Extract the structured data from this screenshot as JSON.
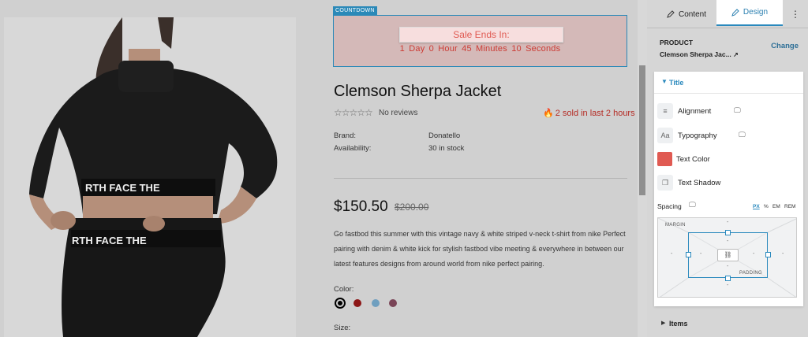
{
  "countdown": {
    "tag": "COUNTDOWN",
    "heading": "Sale Ends In:",
    "timer": "1 Day  0 Hour  45 Minutes  10 Seconds"
  },
  "product": {
    "title": "Clemson Sherpa Jacket",
    "stars": "☆☆☆☆☆",
    "reviews": "No reviews",
    "sold": "2 sold in last 2 hours",
    "brand_label": "Brand:",
    "brand_value": "Donatello",
    "availability_label": "Availability:",
    "availability_value": "30 in stock",
    "price": "$150.50",
    "old_price": "$200.00",
    "description": "Go fastbod this summer with this vintage navy & white striped v-neck t-shirt from nike Perfect pairing with denim & white kick for stylish fastbod vibe meeting & everywhere in between our latest features designs from around world from nike perfect pairing.",
    "color_label": "Color:",
    "swatches": [
      "#000000",
      "#8c1616",
      "#6f9fbf",
      "#7a4557"
    ],
    "size_label": "Size:",
    "image_print_1": "RTH FACE  THE",
    "image_print_2": "RTH FACE  THE"
  },
  "panel": {
    "tab_content": "Content",
    "tab_design": "Design",
    "kebab": "⋮",
    "product_label": "PRODUCT",
    "product_name": "Clemson Sherpa Jac...",
    "change": "Change",
    "section_title": "Title",
    "options": {
      "alignment": "Alignment",
      "typography": "Typography",
      "text_color": "Text Color",
      "text_shadow": "Text Shadow"
    },
    "text_color_value": "#e05a52",
    "spacing_label": "Spacing",
    "units": [
      "PX",
      "%",
      "EM",
      "REM"
    ],
    "margin_label": "MARGIN",
    "padding_label": "PADDING",
    "dash": "-",
    "items_label": "Items"
  }
}
